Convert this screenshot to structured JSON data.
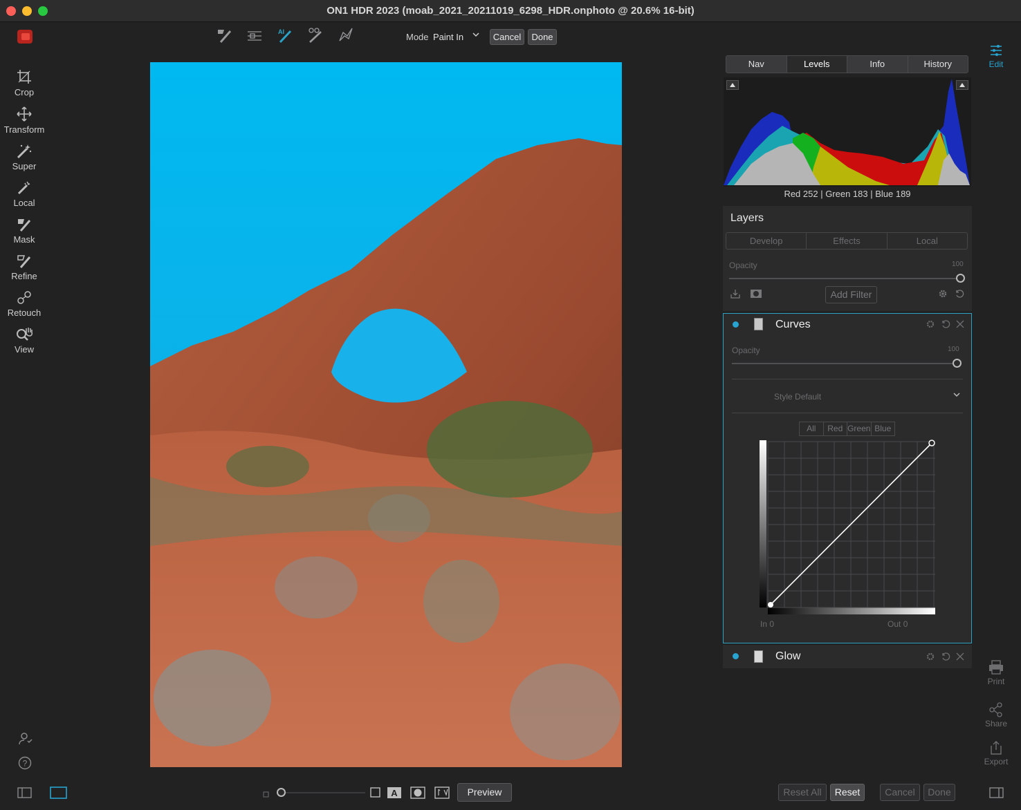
{
  "window": {
    "title": "ON1 HDR 2023 (moab_2021_20211019_6298_HDR.onphoto @ 20.6% 16-bit)"
  },
  "left_tools": [
    {
      "label": "Crop",
      "icon": "crop-icon"
    },
    {
      "label": "Transform",
      "icon": "move-icon"
    },
    {
      "label": "Super",
      "icon": "magic-brush-icon"
    },
    {
      "label": "Local",
      "icon": "brush-icon"
    },
    {
      "label": "Mask",
      "icon": "mask-brush-icon"
    },
    {
      "label": "Refine",
      "icon": "refine-brush-icon"
    },
    {
      "label": "Retouch",
      "icon": "retouch-icon"
    },
    {
      "label": "View",
      "icon": "zoom-hand-icon"
    }
  ],
  "toolbar": {
    "mode_label": "Mode",
    "mode_value": "Paint In",
    "cancel": "Cancel",
    "done": "Done"
  },
  "panel_tabs": [
    "Nav",
    "Levels",
    "Info",
    "History"
  ],
  "panel_active_tab": "Levels",
  "readout": "Red 252 | Green 183 | Blue 189",
  "layers": {
    "title": "Layers",
    "tabs": [
      "Develop",
      "Effects",
      "Local"
    ],
    "opacity_label": "Opacity",
    "opacity_value": "100",
    "opacity_level": 1.0,
    "add_filter": "Add Filter"
  },
  "curves": {
    "name": "Curves",
    "opacity_label": "Opacity",
    "opacity_value": "100",
    "opacity_level": 1.0,
    "style_label": "Style",
    "style_value": "Default",
    "channels": [
      "All",
      "Red",
      "Green",
      "Blue"
    ],
    "in_label": "In",
    "in_value": "0",
    "out_label": "Out",
    "out_value": "0"
  },
  "glow": {
    "name": "Glow"
  },
  "right_modules": {
    "edit": "Edit",
    "print": "Print",
    "share": "Share",
    "export": "Export"
  },
  "bottom": {
    "preview": "Preview",
    "reset_all": "Reset All",
    "reset": "Reset",
    "cancel": "Cancel",
    "done": "Done"
  },
  "colors": {
    "accent": "#27a4d0",
    "sky": "#16b3ec",
    "rock": "#a34f33",
    "sand": "#c5684a"
  }
}
